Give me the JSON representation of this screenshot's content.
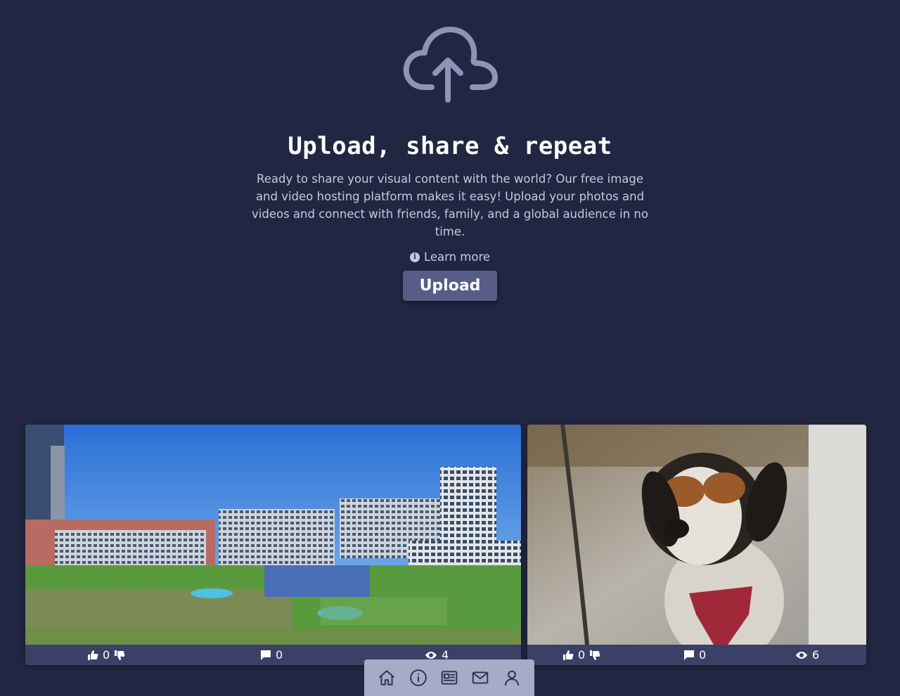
{
  "hero": {
    "icon": "cloud-upload-icon",
    "title": "Upload, share & repeat",
    "description": "Ready to share your visual content with the world? Our free image and video hosting platform makes it easy! Upload your photos and videos and connect with friends, family, and a global audience in no time.",
    "learn_more_label": "Learn more",
    "upload_label": "Upload"
  },
  "cards": [
    {
      "image": "resort-aerial-photo",
      "likes": "0",
      "comments": "0",
      "views": "4"
    },
    {
      "image": "dog-photo",
      "likes": "0",
      "comments": "0",
      "views": "6"
    }
  ],
  "nav": {
    "items": [
      "home-icon",
      "info-icon",
      "news-icon",
      "mail-icon",
      "user-icon"
    ]
  },
  "colors": {
    "background": "#212742",
    "button": "#575d86",
    "card_footer": "#3b4066",
    "nav": "#a7abc7"
  }
}
